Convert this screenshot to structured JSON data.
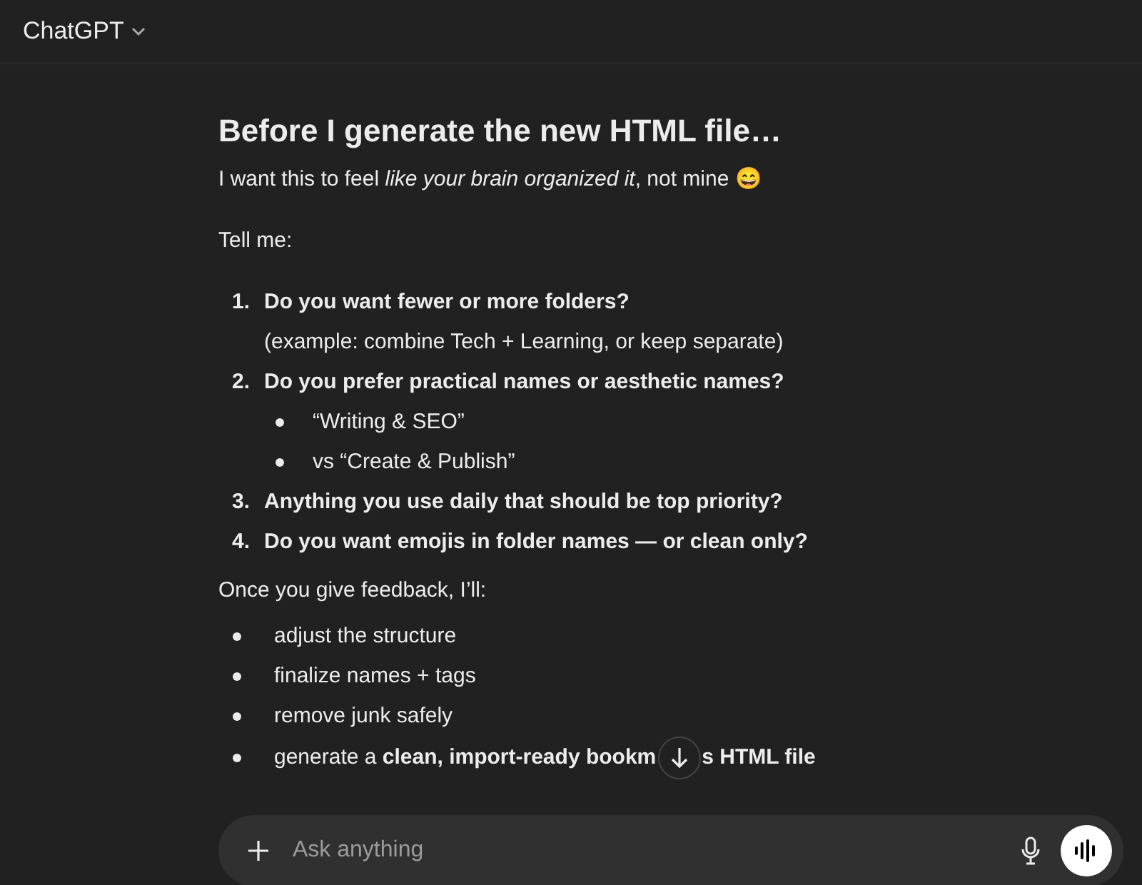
{
  "header": {
    "title": "ChatGPT"
  },
  "message": {
    "heading": "Before I generate the new HTML file…",
    "intro": "I want this to feel *like your brain organized it*, not mine 😄",
    "prompt": "Tell me:",
    "questions": [
      {
        "number": "1.",
        "text": "Do you want fewer or more folders?",
        "note": "(example: combine Tech + Learning, or keep separate)"
      },
      {
        "number": "2.",
        "text": "Do you prefer practical names or aesthetic names?",
        "options": [
          "“Writing & SEO”",
          "vs “Create & Publish”"
        ]
      },
      {
        "number": "3.",
        "text": "Anything you use daily that should be top priority?"
      },
      {
        "number": "4.",
        "text": "Do you want emojis in folder names — or clean only?"
      }
    ],
    "followup": "Once you give feedback, I’ll:",
    "steps": [
      [
        "adjust the structure"
      ],
      [
        "finalize names + tags"
      ],
      [
        "remove junk safely"
      ],
      [
        "generate a **clean, import-ready bookm**",
        "**s HTML file**"
      ]
    ]
  },
  "composer": {
    "placeholder": "Ask anything"
  }
}
